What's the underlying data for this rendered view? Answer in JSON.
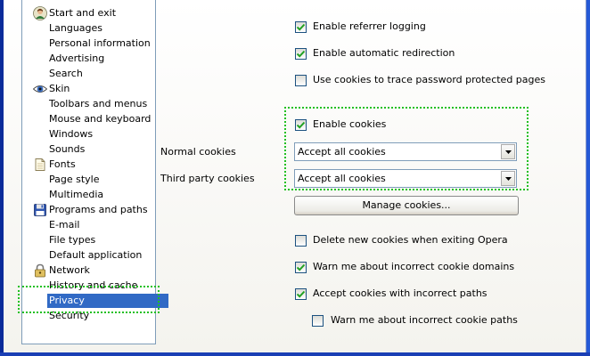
{
  "sidebar": {
    "items": [
      {
        "label": "Start and exit",
        "icon": "person-icon"
      },
      {
        "label": "Languages"
      },
      {
        "label": "Personal information"
      },
      {
        "label": "Advertising"
      },
      {
        "label": "Search"
      },
      {
        "label": "Skin",
        "icon": "eye-icon"
      },
      {
        "label": "Toolbars and menus"
      },
      {
        "label": "Mouse and keyboard"
      },
      {
        "label": "Windows"
      },
      {
        "label": "Sounds"
      },
      {
        "label": "Fonts",
        "icon": "page-icon"
      },
      {
        "label": "Page style"
      },
      {
        "label": "Multimedia"
      },
      {
        "label": "Programs and paths",
        "icon": "floppy-icon"
      },
      {
        "label": "E-mail"
      },
      {
        "label": "File types"
      },
      {
        "label": "Default application"
      },
      {
        "label": "Network",
        "icon": "lock-icon"
      },
      {
        "label": "History and cache"
      },
      {
        "label": "Privacy",
        "selected": true
      },
      {
        "label": "Security"
      }
    ]
  },
  "options": {
    "referrer_logging": {
      "label": "Enable referrer logging",
      "checked": true
    },
    "automatic_redirection": {
      "label": "Enable automatic redirection",
      "checked": true
    },
    "cookies_trace_passwords": {
      "label": "Use cookies to trace password protected pages",
      "checked": false
    },
    "enable_cookies": {
      "label": "Enable cookies",
      "checked": true
    },
    "delete_cookies_on_exit": {
      "label": "Delete new cookies when exiting Opera",
      "checked": false
    },
    "warn_incorrect_domains": {
      "label": "Warn me about incorrect cookie domains",
      "checked": true
    },
    "accept_incorrect_paths": {
      "label": "Accept cookies with incorrect paths",
      "checked": true
    },
    "warn_incorrect_paths": {
      "label": "Warn me about incorrect cookie paths",
      "checked": false
    }
  },
  "normal_cookies": {
    "label": "Normal cookies",
    "value": "Accept all cookies"
  },
  "third_party_cookies": {
    "label": "Third party cookies",
    "value": "Accept all cookies"
  },
  "manage_cookies_button": "Manage cookies...",
  "colors": {
    "selection": "#316ac5",
    "highlight_outline": "#22c022",
    "window_frame": "#2a52be"
  }
}
